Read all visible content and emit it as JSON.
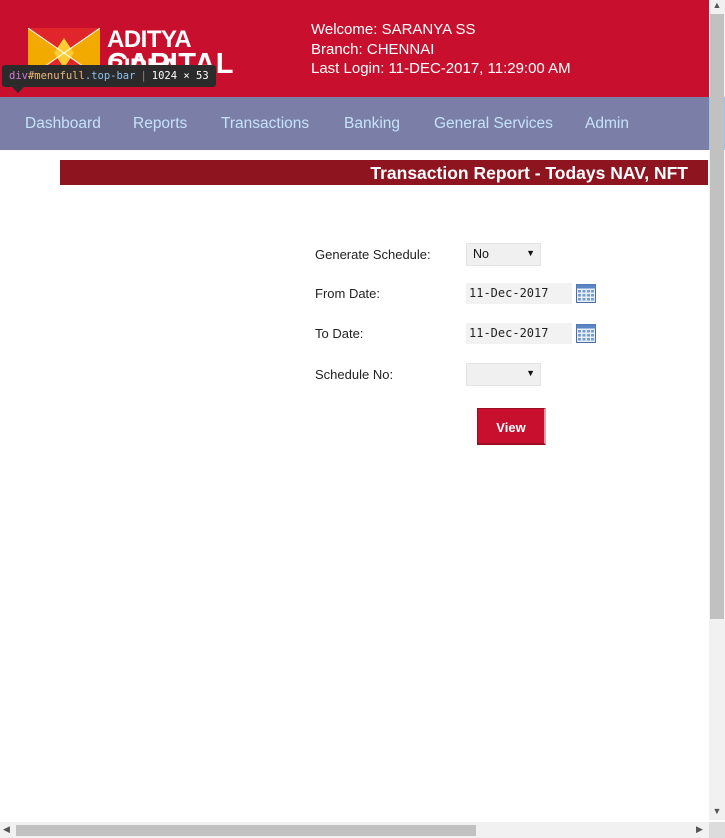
{
  "brand": {
    "line1": "ADITYA BIRLA",
    "line2": "CAPITAL",
    "logo_icon": "aditya-birla-sun-logo"
  },
  "user": {
    "welcome": "Welcome: SARANYA SS",
    "branch": "Branch: CHENNAI",
    "last_login": "Last Login: 11-DEC-2017, 11:29:00 AM"
  },
  "devtools_tooltip": {
    "selector_tag": "div",
    "selector_id": "#menufull",
    "selector_class": ".top-bar",
    "size": "1024 × 53"
  },
  "nav": {
    "items": [
      "Dashboard",
      "Reports",
      "Transactions",
      "Banking",
      "General Services",
      "Admin"
    ]
  },
  "page": {
    "title": "Transaction Report - Todays NAV, NFT"
  },
  "form": {
    "generate_schedule": {
      "label": "Generate Schedule:",
      "value": "No"
    },
    "from_date": {
      "label": "From Date:",
      "value": "11-Dec-2017"
    },
    "to_date": {
      "label": "To Date:",
      "value": "11-Dec-2017"
    },
    "schedule_no": {
      "label": "Schedule No:",
      "value": ""
    },
    "view_button": "View"
  },
  "colors": {
    "header": "#c8102e",
    "nav": "#7b7fa8",
    "nav_text": "#c5e3f8",
    "title_bar": "#8e1520"
  }
}
